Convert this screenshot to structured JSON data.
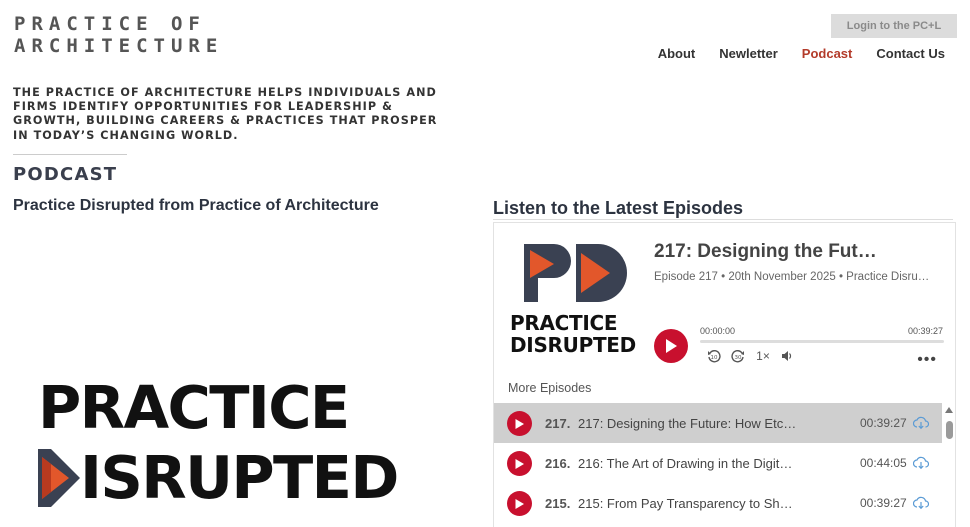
{
  "header": {
    "logo_line1": "PRACTICE OF",
    "logo_line2": "ARCHITECTURE",
    "login_label": "Login to the PC+L",
    "nav": [
      {
        "label": "About"
      },
      {
        "label": "Newletter"
      },
      {
        "label": "Podcast",
        "active": true
      },
      {
        "label": "Contact Us"
      }
    ]
  },
  "intro": {
    "tagline": "The Practice of Architecture helps individuals and firms identify opportunities for leadership & growth, building careers & practices that prosper in today’s changing world.",
    "section_title": "PODCAST",
    "show_title": "Practice Disrupted from Practice of Architecture"
  },
  "cover_art": {
    "line1": "PRACTICE",
    "line2": "ISRUPTED"
  },
  "player": {
    "heading": "Listen to the Latest Episodes",
    "art_line1": "PRACTICE",
    "art_line2": "DISRUPTED",
    "current_title": "217: Designing the Fut…",
    "current_meta": "Episode 217 • 20th November 2025 • Practice Disru…",
    "time_current": "00:00:00",
    "time_total": "00:39:27",
    "speed_label": "1×",
    "more_label": "More Episodes",
    "episodes": [
      {
        "number": "217.",
        "title": "217: Designing the Future: How Etc…",
        "duration": "00:39:27",
        "selected": true
      },
      {
        "number": "216.",
        "title": "216: The Art of Drawing in the Digit…",
        "duration": "00:44:05"
      },
      {
        "number": "215.",
        "title": "215: From Pay Transparency to Sh…",
        "duration": "00:39:27"
      }
    ]
  },
  "colors": {
    "accent": "#c8102e",
    "nav_active": "#b33b2a",
    "pd_dark": "#3a4152",
    "pd_orange": "#e2572b"
  }
}
